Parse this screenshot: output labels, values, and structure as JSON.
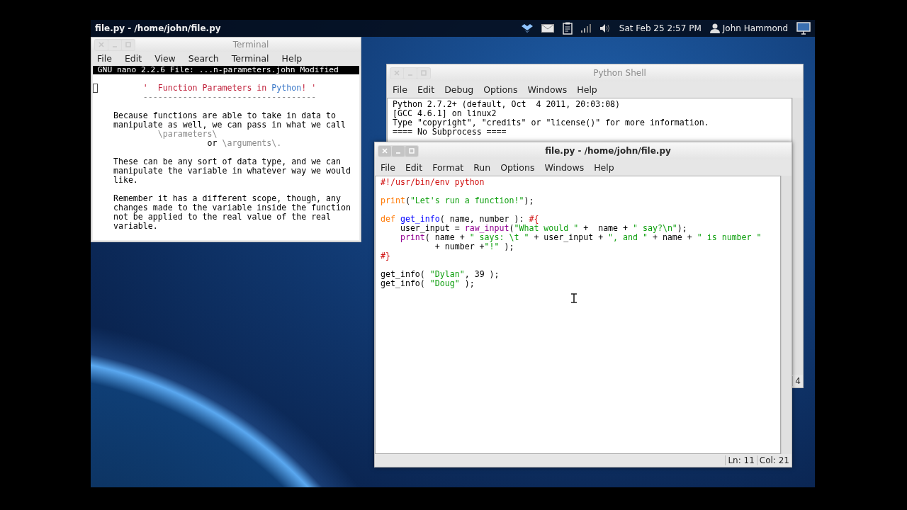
{
  "panel": {
    "title": "file.py - /home/john/file.py",
    "clock": "Sat Feb 25  2:57 PM",
    "user": "John Hammond"
  },
  "terminal": {
    "title": "Terminal",
    "active": false,
    "menu": [
      "File",
      "Edit",
      "View",
      "Search",
      "Terminal",
      "Help"
    ],
    "nano_status": " GNU nano 2.2.6 File: ...n-parameters.john Modified",
    "lines": [
      {
        "kind": "text",
        "segments": [
          {
            "text": "         '  Function Parameters in ",
            "kind": "heading"
          },
          {
            "text": "Python",
            "kind": "highlight"
          },
          {
            "text": "! '",
            "kind": "heading"
          }
        ]
      },
      {
        "kind": "text",
        "segments": [
          {
            "text": "         -----------------------------------",
            "kind": "dim"
          }
        ]
      },
      {
        "kind": "blank"
      },
      {
        "kind": "text",
        "segments": [
          {
            "text": "   Because functions are able to take in data to",
            "kind": "plain"
          }
        ]
      },
      {
        "kind": "text",
        "segments": [
          {
            "text": "   manipulate as well, we can pass in what we call",
            "kind": "plain"
          }
        ]
      },
      {
        "kind": "text",
        "segments": [
          {
            "text": "            \\parameters\\",
            "kind": "dim"
          }
        ]
      },
      {
        "kind": "text",
        "segments": [
          {
            "text": "                      or ",
            "kind": "plain"
          },
          {
            "text": "\\arguments\\.",
            "kind": "dim"
          }
        ]
      },
      {
        "kind": "blank"
      },
      {
        "kind": "text",
        "segments": [
          {
            "text": "   These can be any sort of data type, and we can",
            "kind": "plain"
          }
        ]
      },
      {
        "kind": "text",
        "segments": [
          {
            "text": "   manipulate the variable in whatever way we would",
            "kind": "plain"
          }
        ]
      },
      {
        "kind": "text",
        "segments": [
          {
            "text": "   like.",
            "kind": "plain"
          }
        ]
      },
      {
        "kind": "blank"
      },
      {
        "kind": "text",
        "segments": [
          {
            "text": "   Remember it has a different scope, though, any",
            "kind": "plain"
          }
        ]
      },
      {
        "kind": "text",
        "segments": [
          {
            "text": "   changes made to the variable inside the function",
            "kind": "plain"
          }
        ]
      },
      {
        "kind": "text",
        "segments": [
          {
            "text": "   not be applied to the real value of the real",
            "kind": "plain"
          }
        ]
      },
      {
        "kind": "text",
        "segments": [
          {
            "text": "   variable.",
            "kind": "plain"
          }
        ]
      }
    ]
  },
  "python_shell": {
    "title": "Python Shell",
    "active": false,
    "menu": [
      "File",
      "Edit",
      "Debug",
      "Options",
      "Windows",
      "Help"
    ],
    "lines": [
      {
        "kind": "text",
        "segments": [
          {
            "text": "Python 2.7.2+ (default, Oct  4 2011, 20:03:08)",
            "kind": "plain"
          }
        ]
      },
      {
        "kind": "text",
        "segments": [
          {
            "text": "[GCC 4.6.1] on linux2",
            "kind": "plain"
          }
        ]
      },
      {
        "kind": "text",
        "segments": [
          {
            "text": "Type \"copyright\", \"credits\" or \"license()\" for more information.",
            "kind": "plain"
          }
        ]
      },
      {
        "kind": "text",
        "segments": [
          {
            "text": "==== No Subprocess ====",
            "kind": "plain"
          }
        ]
      }
    ],
    "status": "4"
  },
  "editor": {
    "title": "file.py - /home/john/file.py",
    "active": true,
    "menu": [
      "File",
      "Edit",
      "Format",
      "Run",
      "Options",
      "Windows",
      "Help"
    ],
    "lines": [
      {
        "kind": "text",
        "segments": [
          {
            "text": "#!/usr/bin/env python",
            "kind": "comment"
          }
        ]
      },
      {
        "kind": "blank"
      },
      {
        "kind": "text",
        "segments": [
          {
            "text": "print",
            "kind": "keyword"
          },
          {
            "text": "(",
            "kind": "plain"
          },
          {
            "text": "\"Let's run a function!\"",
            "kind": "string"
          },
          {
            "text": ");",
            "kind": "plain"
          }
        ]
      },
      {
        "kind": "blank"
      },
      {
        "kind": "text",
        "segments": [
          {
            "text": "def ",
            "kind": "keyword"
          },
          {
            "text": "get_info",
            "kind": "defname"
          },
          {
            "text": "( name, number ): ",
            "kind": "plain"
          },
          {
            "text": "#{",
            "kind": "comment"
          }
        ]
      },
      {
        "kind": "text",
        "segments": [
          {
            "text": "    user_input = ",
            "kind": "plain"
          },
          {
            "text": "raw_input",
            "kind": "builtin"
          },
          {
            "text": "(",
            "kind": "plain"
          },
          {
            "text": "\"What would \"",
            "kind": "string"
          },
          {
            "text": " +  name + ",
            "kind": "plain"
          },
          {
            "text": "\" say?\\n\"",
            "kind": "string"
          },
          {
            "text": ");",
            "kind": "plain"
          }
        ]
      },
      {
        "kind": "text",
        "segments": [
          {
            "text": "    print",
            "kind": "builtin"
          },
          {
            "text": "( name + ",
            "kind": "plain"
          },
          {
            "text": "\" says: \\t \"",
            "kind": "string"
          },
          {
            "text": " + user_input + ",
            "kind": "plain"
          },
          {
            "text": "\", and \"",
            "kind": "string"
          },
          {
            "text": " + name + ",
            "kind": "plain"
          },
          {
            "text": "\" is number \"",
            "kind": "string"
          }
        ]
      },
      {
        "kind": "text",
        "segments": [
          {
            "text": "           + number +",
            "kind": "plain"
          },
          {
            "text": "\"!\"",
            "kind": "string"
          },
          {
            "text": " );",
            "kind": "plain"
          }
        ]
      },
      {
        "kind": "text",
        "segments": [
          {
            "text": "#}",
            "kind": "comment"
          }
        ]
      },
      {
        "kind": "blank"
      },
      {
        "kind": "text",
        "segments": [
          {
            "text": "get_info( ",
            "kind": "plain"
          },
          {
            "text": "\"Dylan\"",
            "kind": "string"
          },
          {
            "text": ", 39 );",
            "kind": "plain"
          }
        ]
      },
      {
        "kind": "text",
        "segments": [
          {
            "text": "get_info( ",
            "kind": "plain"
          },
          {
            "text": "\"Doug\"",
            "kind": "string"
          },
          {
            "text": " );",
            "kind": "plain"
          }
        ]
      }
    ],
    "status": {
      "line": "Ln: 11",
      "column": "Col: 21"
    }
  }
}
